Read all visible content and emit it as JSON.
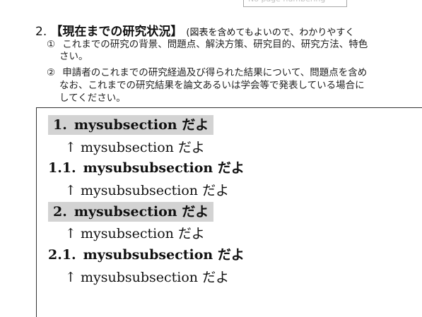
{
  "top_box_text": "No page numbering",
  "heading": {
    "number": "2.",
    "title": "【現在までの研究状況】",
    "note": "(図表を含めてもよいので、わかりやすく"
  },
  "instructions": [
    {
      "marker": "①",
      "line1": "これまでの研究の背景、問題点、解決方策、研究目的、研究方法、特色",
      "line2": "さい。"
    },
    {
      "marker": "②",
      "line1": "申請者のこれまでの研究経過及び得られた結果について、問題点を含め",
      "line2": "なお、これまでの研究結果を論文あるいは学会等で発表している場合に",
      "line3": "してください。"
    }
  ],
  "content": [
    {
      "number": "1.",
      "heading": "mysubsection だよ",
      "body": "↑ mysubsection だよ"
    },
    {
      "number": "1.1.",
      "heading": "mysubsubsection だよ",
      "body": "↑ mysubsubsection だよ"
    },
    {
      "number": "2.",
      "heading": "mysubsection だよ",
      "body": "↑ mysubsection だよ"
    },
    {
      "number": "2.1.",
      "heading": "mysubsubsection だよ",
      "body": "↑ mysubsubsection だよ"
    }
  ]
}
